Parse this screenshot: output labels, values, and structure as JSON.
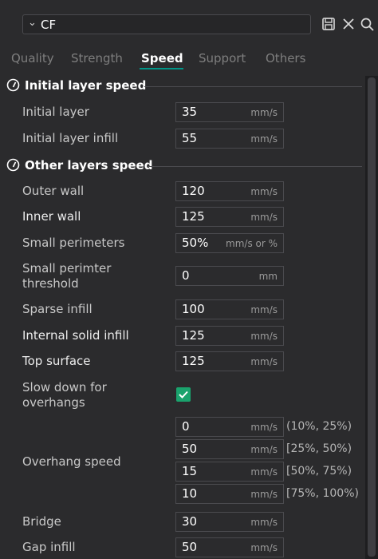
{
  "preset": {
    "name": "CF"
  },
  "tabs": [
    "Quality",
    "Strength",
    "Speed",
    "Support",
    "Others"
  ],
  "sections": {
    "initial": {
      "title": "Initial layer speed"
    },
    "other": {
      "title": "Other layers speed"
    }
  },
  "rows": {
    "initial_layer": {
      "label": "Initial layer",
      "value": "35",
      "unit": "mm/s"
    },
    "initial_layer_infill": {
      "label": "Initial layer infill",
      "value": "55",
      "unit": "mm/s"
    },
    "outer_wall": {
      "label": "Outer wall",
      "value": "120",
      "unit": "mm/s"
    },
    "inner_wall": {
      "label": "Inner wall",
      "value": "125",
      "unit": "mm/s"
    },
    "small_perimeters": {
      "label": "Small perimeters",
      "value": "50%",
      "unit": "mm/s or %"
    },
    "small_perimeter_threshold": {
      "label_line1": "Small perimter",
      "label_line2": "threshold",
      "value": "0",
      "unit": "mm"
    },
    "sparse_infill": {
      "label": "Sparse infill",
      "value": "100",
      "unit": "mm/s"
    },
    "internal_solid_infill": {
      "label": "Internal solid infill",
      "value": "125",
      "unit": "mm/s"
    },
    "top_surface": {
      "label": "Top surface",
      "value": "125",
      "unit": "mm/s"
    },
    "slow_down_overhangs": {
      "label_line1": "Slow down for",
      "label_line2": "overhangs",
      "checked": true
    },
    "overhang_speed": {
      "label": "Overhang speed",
      "entries": [
        {
          "value": "0",
          "unit": "mm/s",
          "range": "(10%, 25%)"
        },
        {
          "value": "50",
          "unit": "mm/s",
          "range": "[25%, 50%)"
        },
        {
          "value": "15",
          "unit": "mm/s",
          "range": "[50%, 75%)"
        },
        {
          "value": "10",
          "unit": "mm/s",
          "range": "[75%, 100%)"
        }
      ]
    },
    "bridge": {
      "label": "Bridge",
      "value": "30",
      "unit": "mm/s"
    },
    "gap_infill": {
      "label": "Gap infill",
      "value": "50",
      "unit": "mm/s"
    }
  },
  "colors": {
    "accent": "#009688",
    "checkbox": "#1aa36d",
    "background": "#2b2b2d"
  }
}
